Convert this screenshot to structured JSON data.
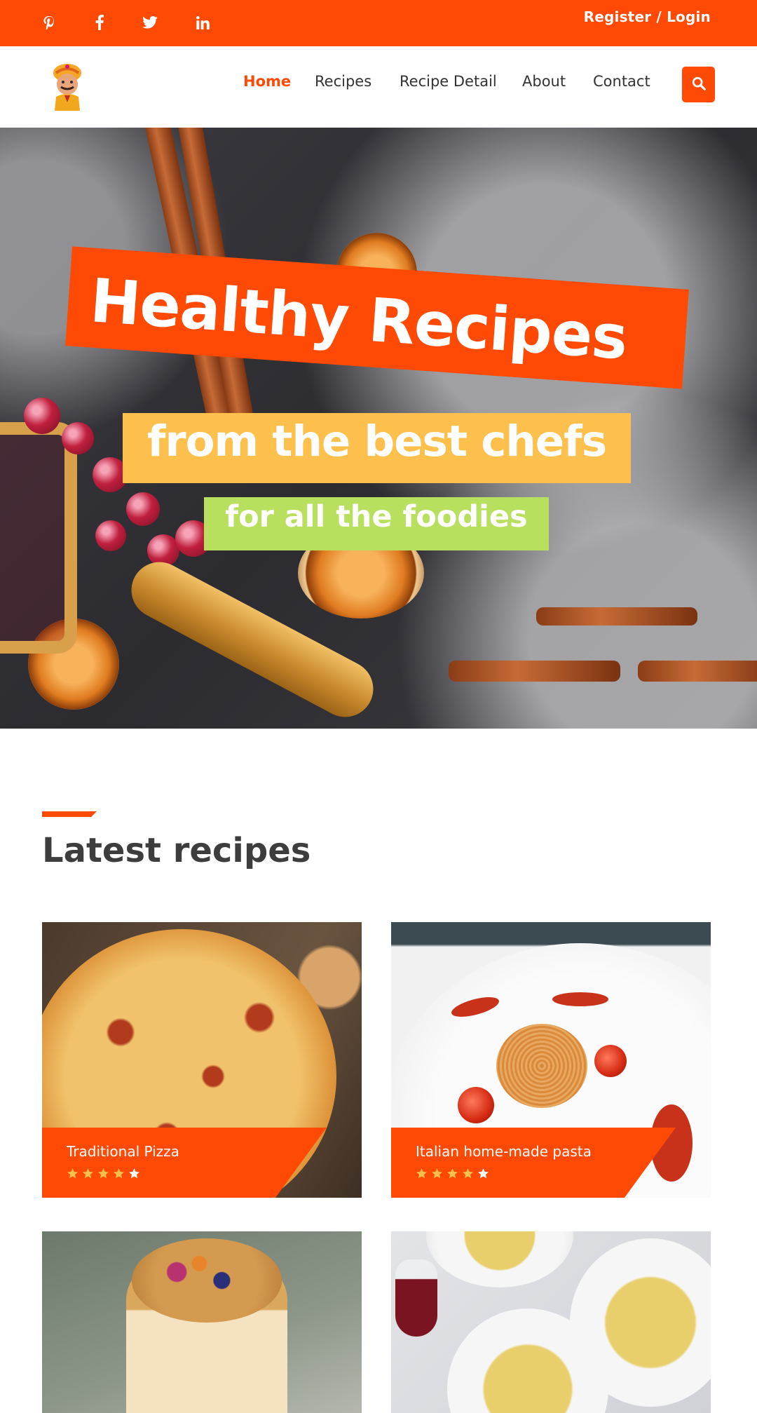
{
  "topbar": {
    "social": [
      {
        "name": "pinterest",
        "icon": "pinterest-icon"
      },
      {
        "name": "facebook",
        "icon": "facebook-icon"
      },
      {
        "name": "twitter",
        "icon": "twitter-icon"
      },
      {
        "name": "linkedin",
        "icon": "linkedin-icon"
      }
    ],
    "auth_label": "Register / Login"
  },
  "header": {
    "logo_icon": "chef-mascot-logo",
    "nav": [
      {
        "label": "Home",
        "active": true
      },
      {
        "label": "Recipes",
        "active": false
      },
      {
        "label": "Recipe Detail",
        "active": false
      },
      {
        "label": "About",
        "active": false
      },
      {
        "label": "Contact",
        "active": false
      }
    ],
    "search_icon": "search-icon"
  },
  "hero": {
    "line1": "Healthy Recipes",
    "line2": "from the best chefs",
    "line3": "for all the foodies"
  },
  "latest": {
    "title": "Latest recipes",
    "cards": [
      {
        "title": "Traditional Pizza",
        "rating": 4,
        "max_rating": 5
      },
      {
        "title": "Italian home-made pasta",
        "rating": 4,
        "max_rating": 5
      },
      {
        "title": "",
        "rating": null
      },
      {
        "title": "",
        "rating": null
      }
    ]
  },
  "colors": {
    "brand": "#ff4a05",
    "banner_yellow": "#fdc04c",
    "banner_green": "#b9df5e",
    "star_filled": "#fdc04c",
    "star_empty": "#ffffff"
  }
}
